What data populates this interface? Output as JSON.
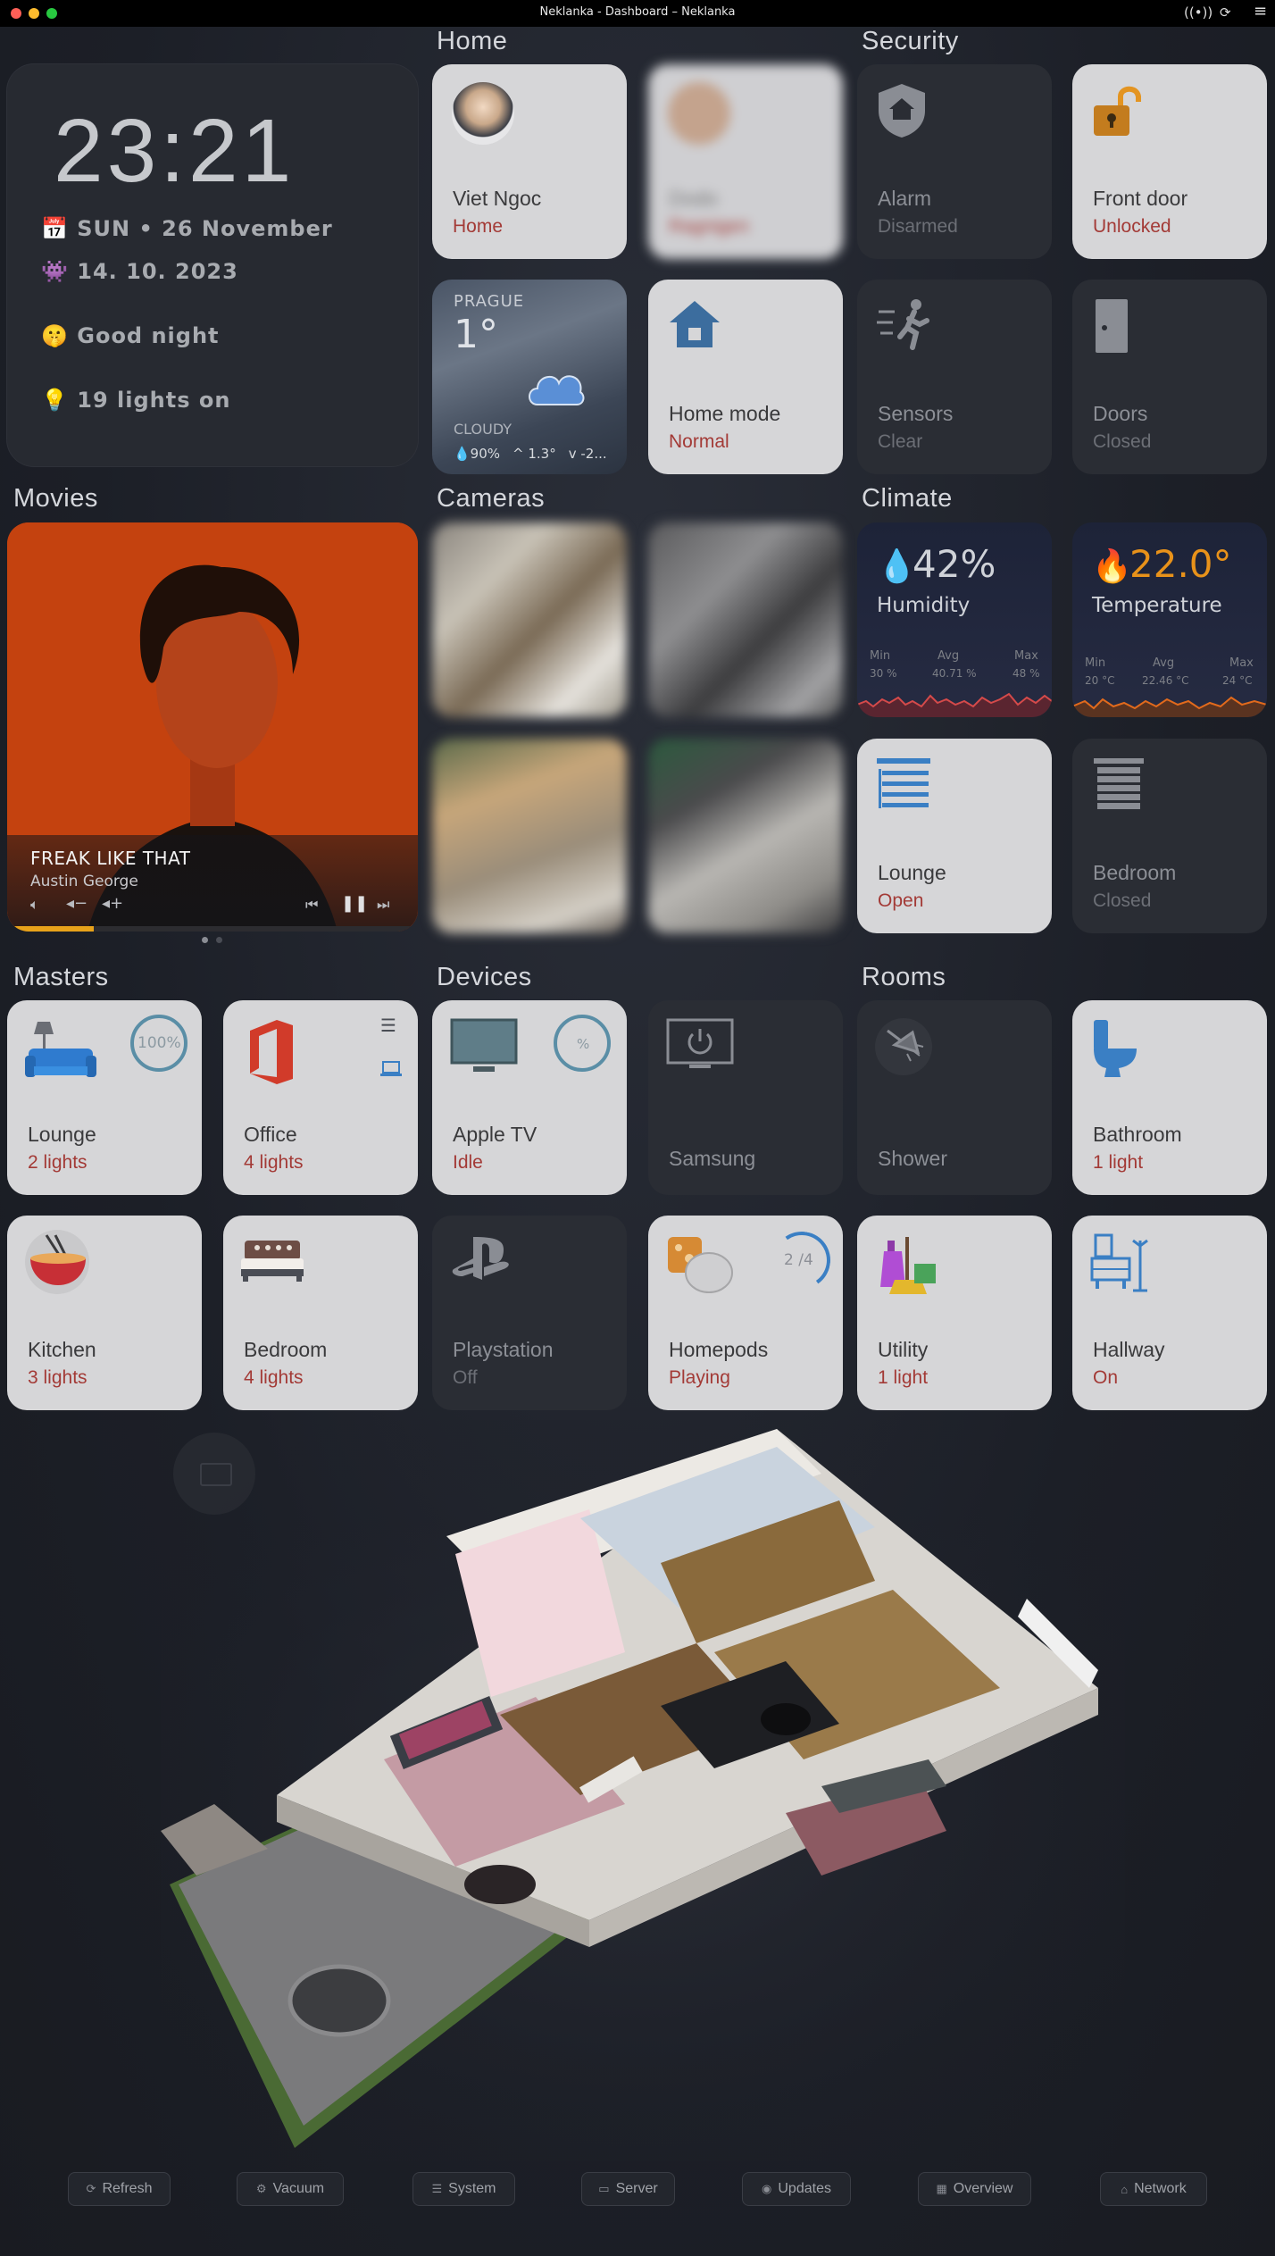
{
  "window": {
    "title": "Neklanka - Dashboard – Neklanka"
  },
  "clock": {
    "time": "23:21",
    "date": "SUN • 26 November",
    "date2": "14. 10. 2023",
    "greeting": "Good night",
    "lights": "19 lights on",
    "date_icon": "📅",
    "date2_icon": "👾",
    "greeting_icon": "🤫",
    "lights_icon": "💡"
  },
  "sections": {
    "home": "Home",
    "security": "Security",
    "movies": "Movies",
    "cameras": "Cameras",
    "climate": "Climate",
    "masters": "Masters",
    "devices": "Devices",
    "rooms": "Rooms"
  },
  "home": {
    "person": {
      "name": "Viet Ngoc",
      "state": "Home"
    },
    "person2": {
      "name": "Dodo",
      "state": "Ragnigen"
    },
    "weather": {
      "city": "PRAGUE",
      "temp": "1°",
      "condition": "CLOUDY",
      "humidity": "💧90%",
      "high": "^ 1.3°",
      "low": "v -2..."
    },
    "mode": {
      "name": "Home mode",
      "state": "Normal"
    }
  },
  "security": {
    "alarm": {
      "name": "Alarm",
      "state": "Disarmed"
    },
    "front_door": {
      "name": "Front door",
      "state": "Unlocked"
    },
    "sensors": {
      "name": "Sensors",
      "state": "Clear"
    },
    "doors": {
      "name": "Doors",
      "state": "Closed"
    }
  },
  "movies": {
    "title": "FREAK LIKE THAT",
    "artist": "Austin George",
    "progress": 0.21
  },
  "climate": {
    "humidity": {
      "value": "42%",
      "label": "Humidity",
      "min_label": "Min",
      "avg_label": "Avg",
      "max_label": "Max",
      "min": "30 %",
      "avg": "40.71 %",
      "max": "48 %"
    },
    "temperature": {
      "value": "22.0°",
      "label": "Temperature",
      "min_label": "Min",
      "avg_label": "Avg",
      "max_label": "Max",
      "min": "20 °C",
      "avg": "22.46 °C",
      "max": "24 °C"
    },
    "lounge": {
      "name": "Lounge",
      "state": "Open"
    },
    "bedroom": {
      "name": "Bedroom",
      "state": "Closed"
    }
  },
  "masters": {
    "lounge": {
      "name": "Lounge",
      "state": "2 lights",
      "percent": "100%"
    },
    "office": {
      "name": "Office",
      "state": "4 lights"
    },
    "kitchen": {
      "name": "Kitchen",
      "state": "3 lights"
    },
    "bedroom": {
      "name": "Bedroom",
      "state": "4 lights"
    }
  },
  "devices": {
    "appletv": {
      "name": "Apple TV",
      "state": "Idle",
      "percent": "%"
    },
    "samsung": {
      "name": "Samsung"
    },
    "playstation": {
      "name": "Playstation",
      "state": "Off"
    },
    "homepods": {
      "name": "Homepods",
      "state": "Playing",
      "count": "2 /4"
    }
  },
  "rooms": {
    "shower": {
      "name": "Shower"
    },
    "bathroom": {
      "name": "Bathroom",
      "state": "1 light"
    },
    "utility": {
      "name": "Utility",
      "state": "1 light"
    },
    "hallway": {
      "name": "Hallway",
      "state": "On"
    }
  },
  "footer": [
    "Refresh",
    "Vacuum",
    "System",
    "Server",
    "Updates",
    "Overview",
    "Network"
  ],
  "colors": {
    "accent_red": "#a33a36",
    "accent_blue": "#3a7fc4",
    "accent_orange": "#e8921a",
    "progress": "#e8a21a"
  }
}
